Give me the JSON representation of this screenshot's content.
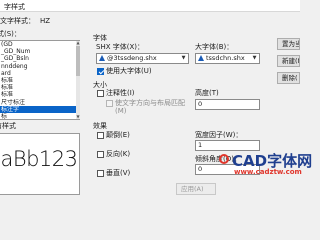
{
  "window": {
    "title": "字样式"
  },
  "current_style": {
    "label": "当前文字样式：",
    "value": "HZ"
  },
  "styles_section": {
    "label": "样式(S)："
  },
  "style_list": [
    {
      "label": "(GD",
      "selected": false
    },
    {
      "label": "_GD_Num",
      "selected": false
    },
    {
      "label": "_GD_Bsln",
      "selected": false
    },
    {
      "label": "nnddeng",
      "selected": false
    },
    {
      "label": "ard",
      "selected": false
    },
    {
      "label": "标准",
      "selected": false
    },
    {
      "label": "标准",
      "selected": false
    },
    {
      "label": "标准",
      "selected": false
    },
    {
      "label": "尺寸标注",
      "selected": false
    },
    {
      "label": "标注字",
      "selected": true
    },
    {
      "label": "标",
      "selected": false
    },
    {
      "label": "字",
      "selected": false
    }
  ],
  "filter": {
    "label": "所有样式"
  },
  "preview": {
    "sample": "aBb123"
  },
  "font": {
    "group_label": "字体",
    "shx_label": "SHX 字体(X)：",
    "shx_value": "@3tssdeng.shx",
    "bigfont_label": "大字体(B)：",
    "bigfont_value": "tssdchn.shx",
    "use_bigfont_label": "使用大字体(U)",
    "use_bigfont_checked": true
  },
  "size": {
    "group_label": "大小",
    "annotative_label": "注释性(I)",
    "annotative_checked": false,
    "match_orientation_label": "使文字方向与布局匹配(M)",
    "height_label": "高度(T)",
    "height_value": "0"
  },
  "effects": {
    "group_label": "效果",
    "upside_down_label": "颠倒(E)",
    "backwards_label": "反向(K)",
    "vertical_label": "垂直(V)",
    "width_factor_label": "宽度因子(W)：",
    "width_factor_value": "1",
    "oblique_label": "倾斜角度(O)：",
    "oblique_value": "0"
  },
  "buttons": {
    "set_current": "置为当前",
    "new": "新建(N)",
    "delete": "删除(",
    "apply": "应用(A)"
  },
  "watermark": {
    "brand": "CAD字体网",
    "url": "www.cadztw.com"
  },
  "colors": {
    "selection": "#0a64c8",
    "watermark_blue": "#1f3f8f",
    "watermark_red": "#e0352b"
  }
}
